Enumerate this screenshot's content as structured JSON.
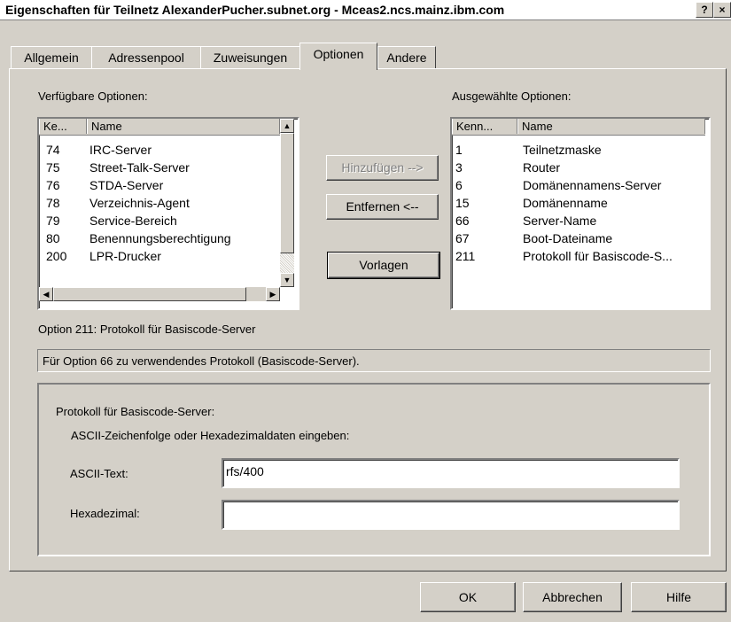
{
  "window": {
    "title": "Eigenschaften für Teilnetz AlexanderPucher.subnet.org - Mceas2.ncs.mainz.ibm.com",
    "help_glyph": "?",
    "close_glyph": "×"
  },
  "tabs": [
    {
      "label": "Allgemein"
    },
    {
      "label": "Adressenpool"
    },
    {
      "label": "Zuweisungen"
    },
    {
      "label": "Optionen"
    },
    {
      "label": "Andere"
    }
  ],
  "available": {
    "heading": "Verfügbare Optionen:",
    "col_id": "Ke...",
    "col_name": "Name",
    "rows": [
      {
        "id": "74",
        "name": "IRC-Server"
      },
      {
        "id": "75",
        "name": "Street-Talk-Server"
      },
      {
        "id": "76",
        "name": "STDA-Server"
      },
      {
        "id": "78",
        "name": "Verzeichnis-Agent"
      },
      {
        "id": "79",
        "name": "Service-Bereich"
      },
      {
        "id": "80",
        "name": "Benennungsberechtigung"
      },
      {
        "id": "200",
        "name": "LPR-Drucker"
      }
    ]
  },
  "selected": {
    "heading": "Ausgewählte Optionen:",
    "col_id": "Kenn...",
    "col_name": "Name",
    "rows": [
      {
        "id": "1",
        "name": "Teilnetzmaske"
      },
      {
        "id": "3",
        "name": "Router"
      },
      {
        "id": "6",
        "name": "Domänennamens-Server"
      },
      {
        "id": "15",
        "name": "Domänenname"
      },
      {
        "id": "66",
        "name": "Server-Name"
      },
      {
        "id": "67",
        "name": "Boot-Dateiname"
      },
      {
        "id": "211",
        "name": "Protokoll für Basiscode-S..."
      }
    ]
  },
  "buttons": {
    "add": "Hinzufügen -->",
    "remove": "Entfernen <--",
    "templates": "Vorlagen",
    "ok": "OK",
    "cancel": "Abbrechen",
    "help": "Hilfe"
  },
  "option": {
    "title": "Option 211:  Protokoll für Basiscode-Server",
    "description": "Für Option 66 zu verwendendes Protokoll (Basiscode-Server).",
    "group_label": "Protokoll für Basiscode-Server:",
    "instruction": "ASCII-Zeichenfolge oder Hexadezimaldaten eingeben:",
    "ascii_label": "ASCII-Text:",
    "ascii_value": "rfs/400",
    "hex_label": "Hexadezimal:",
    "hex_value": ""
  }
}
